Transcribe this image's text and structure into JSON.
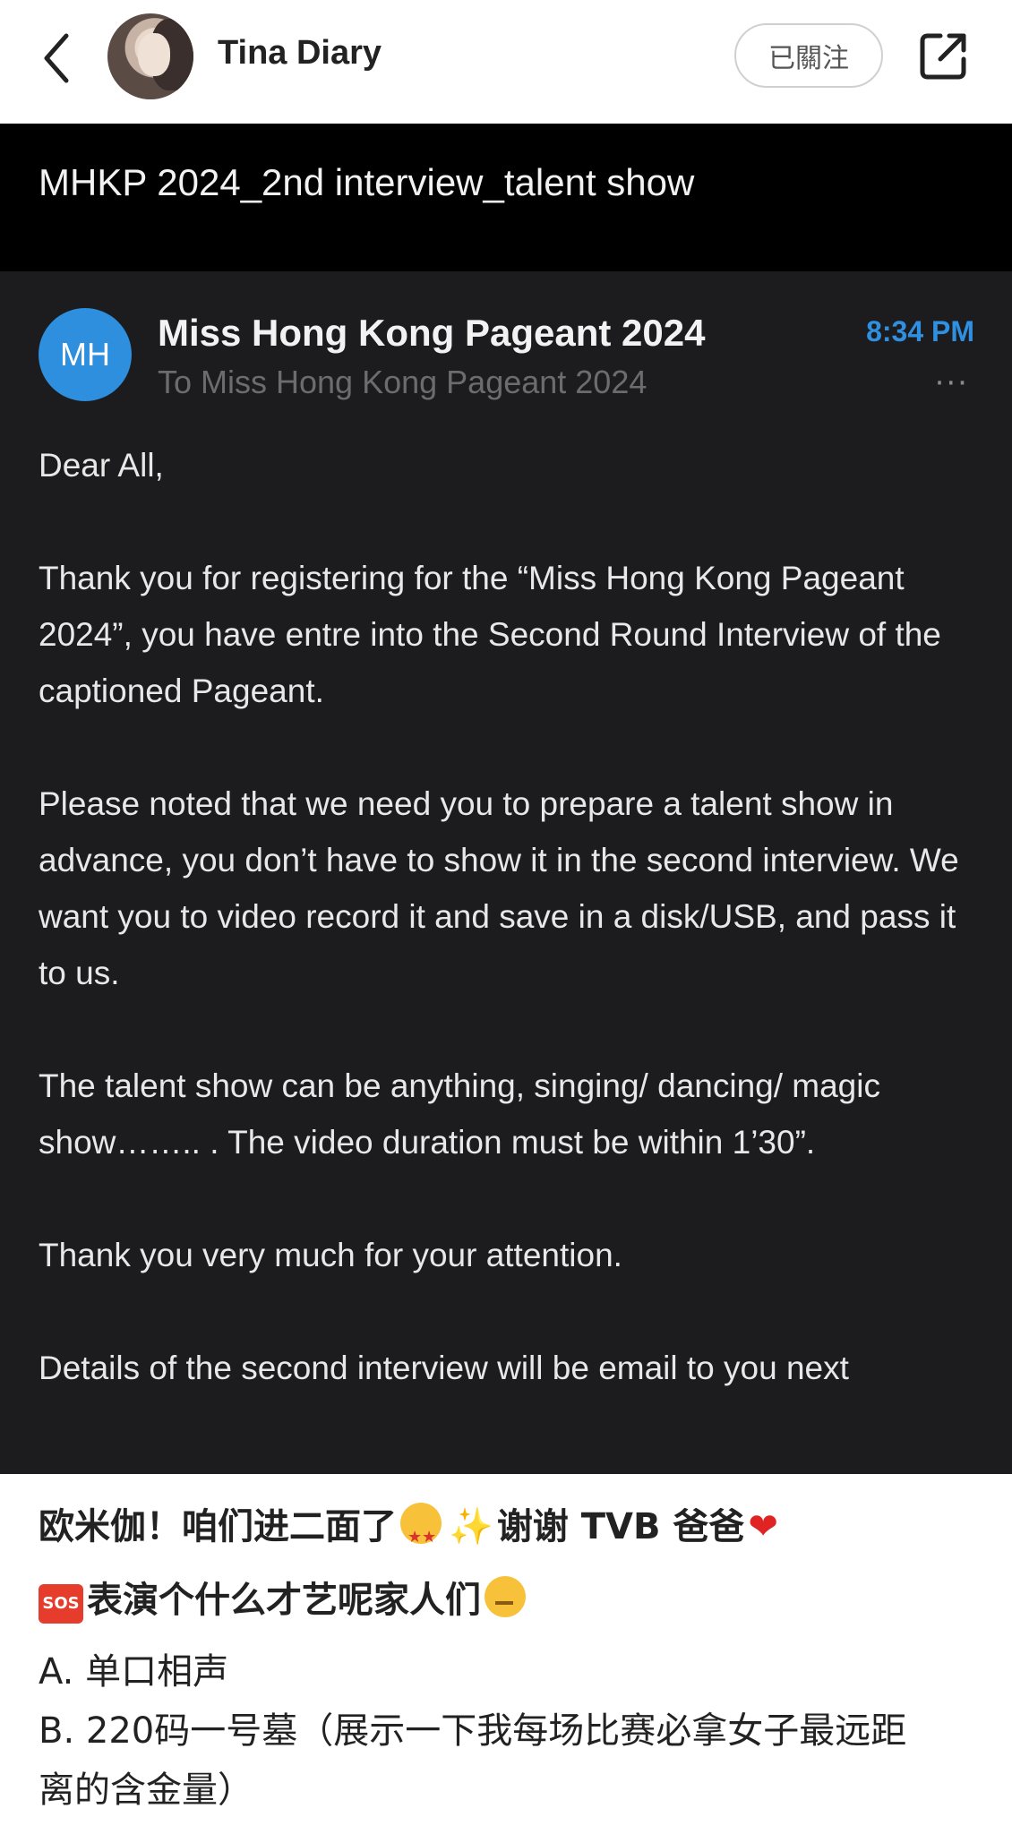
{
  "header": {
    "back_icon": "chevron-left-icon",
    "username": "Tina Diary",
    "follow_label": "已關注",
    "share_icon": "share-external-icon"
  },
  "email": {
    "subject": "MHKP 2024_2nd interview_talent show",
    "sender_initials": "MH",
    "sender_name": "Miss Hong Kong Pageant 2024",
    "recipient": "To Miss Hong Kong Pageant 2024",
    "time": "8:34 PM",
    "more_label": "···",
    "accent_color": "#2d8fde",
    "paragraphs": [
      "Dear All,",
      "Thank you for registering for the “Miss Hong Kong Pageant 2024”, you have entre into the Second Round Interview of the captioned Pageant.",
      "Please noted that we need you to prepare a talent show in advance, you don’t have to show it in the second interview. We want you to video record it and save in a disk/USB, and pass it to us.",
      "The talent show can be anything, singing/ dancing/ magic show…….. . The video duration must be within 1’30”.",
      "Thank you very much for your attention.",
      "Details of the second interview will be email to you next"
    ]
  },
  "caption": {
    "line1_part1": "欧米伽！咱们进二面了",
    "line1_part2": "谢谢 TVB 爸爸",
    "sos_label": "SOS",
    "line2": "表演个什么才艺呢家人们",
    "option_a": "A. 单口相声",
    "option_b_1": "B. 220码一号墓（展示一下我每场比赛必拿女子最远距",
    "option_b_2": "离的含金量）"
  }
}
